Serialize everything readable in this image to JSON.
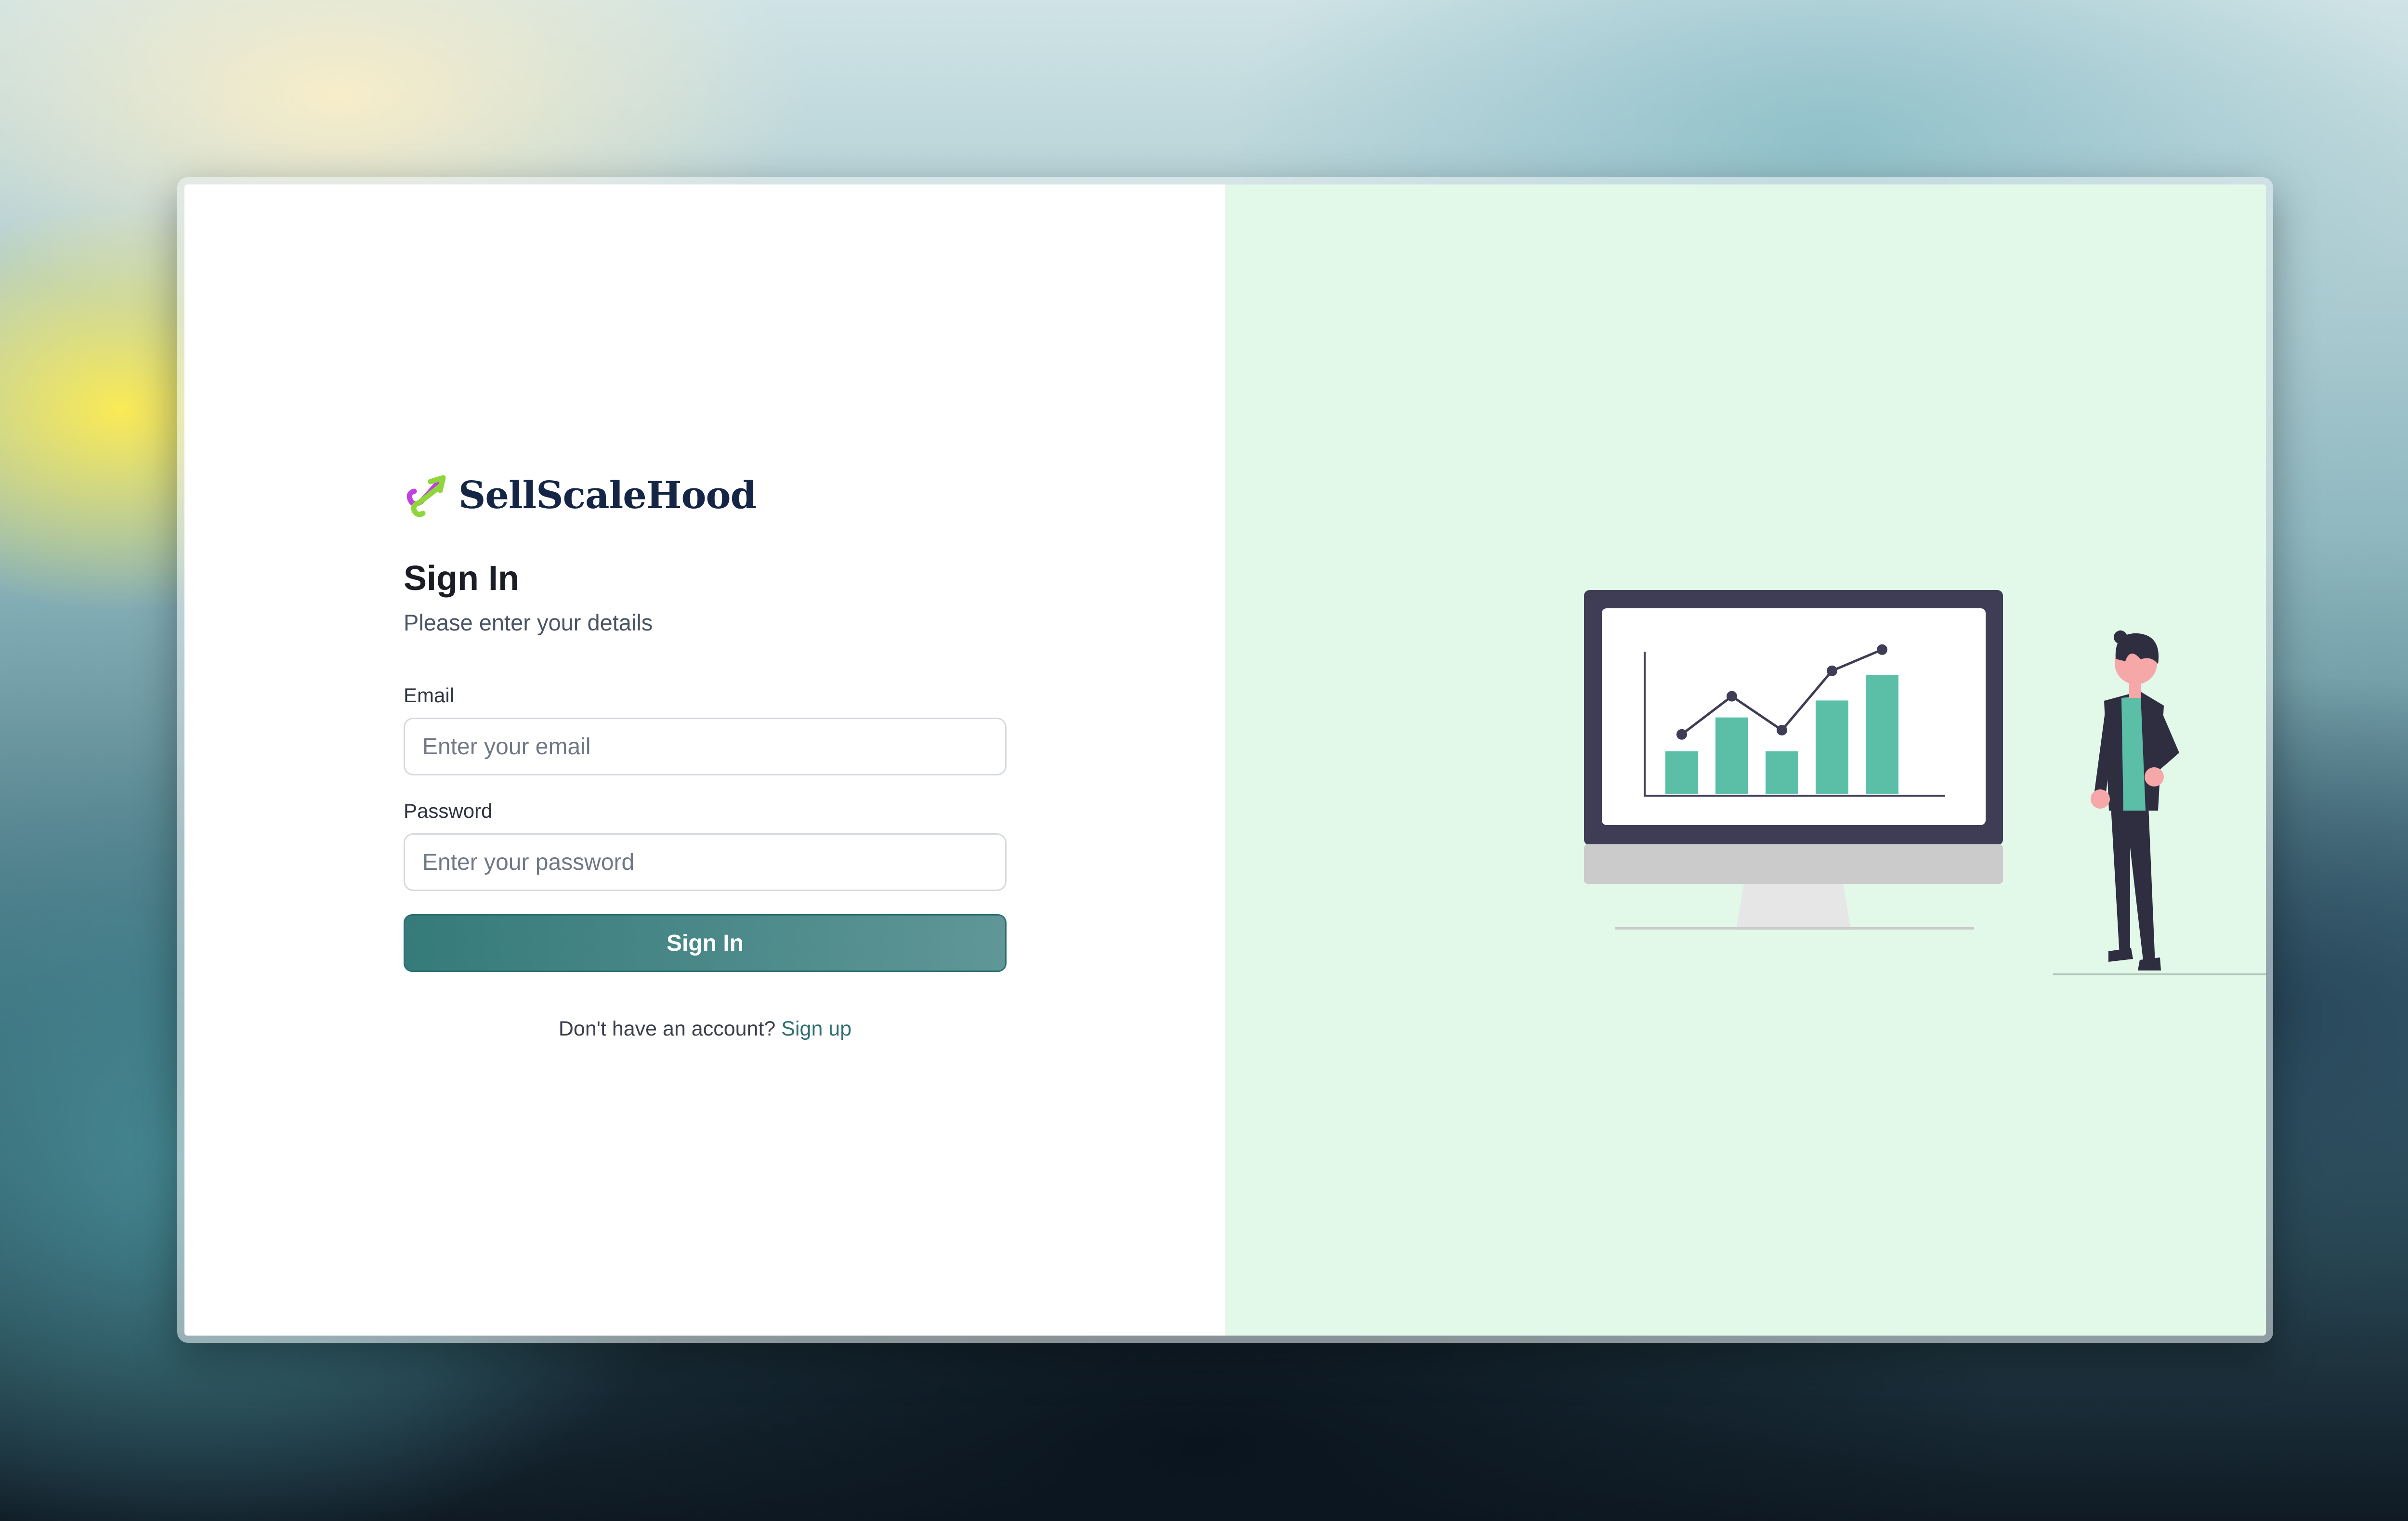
{
  "brand": {
    "name": "SellScaleHood",
    "logo_icon": "arrow-loop-logo-icon",
    "logo_colors": [
      "#c040e0",
      "#8fd63a"
    ]
  },
  "signin": {
    "title": "Sign In",
    "subtitle": "Please enter your details",
    "email_label": "Email",
    "email_placeholder": "Enter your email",
    "password_label": "Password",
    "password_placeholder": "Enter your password",
    "submit_label": "Sign In",
    "no_account_text": "Don't have an account?",
    "signup_label": "Sign up"
  },
  "colors": {
    "accent": "#357b7a",
    "illustration_bg": "#e2f8e8",
    "chart_bars": "#5bbfa8",
    "brand_text": "#152545"
  },
  "illustration": {
    "name": "analytics-presenter-illustration",
    "chart_data": {
      "type": "bar",
      "values": [
        1.0,
        1.8,
        1.0,
        2.2,
        2.8
      ],
      "line_values": [
        1.4,
        2.3,
        1.5,
        2.9,
        3.4
      ]
    }
  }
}
